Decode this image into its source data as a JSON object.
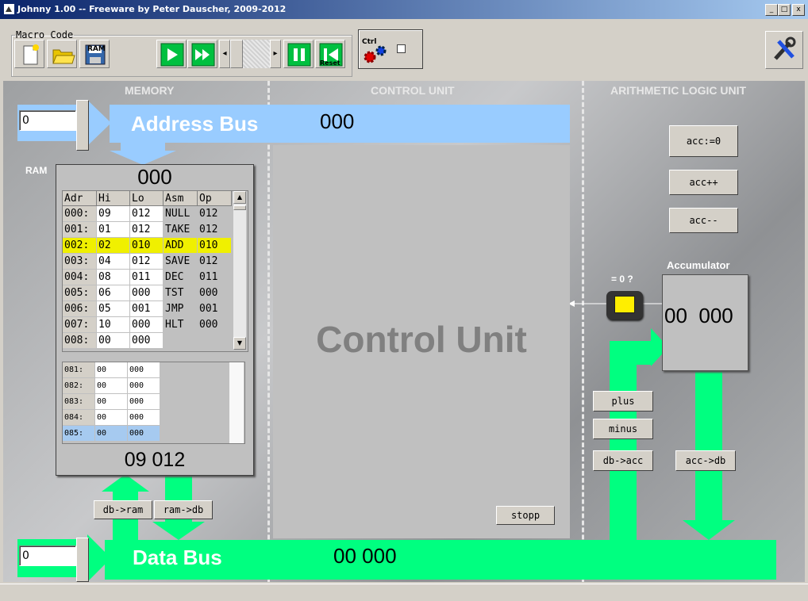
{
  "window": {
    "title": "Johnny 1.00 --  Freeware by Peter Dauscher, 2009-2012",
    "min": "_",
    "max": "□",
    "close": "x"
  },
  "toolbar": {
    "macro_group_label": "Macro Code",
    "ram_label": "RAM",
    "ctrl_label": "Ctrl",
    "reset_label": "Reset"
  },
  "sections": {
    "memory": "MEMORY",
    "control": "CONTROL UNIT",
    "alu": "ARITHMETIC LOGIC UNIT"
  },
  "address_bus": {
    "title": "Address Bus",
    "value": "000",
    "input_value": "0"
  },
  "data_bus": {
    "title": "Data Bus",
    "value": "00  000",
    "input_value": "0"
  },
  "ram": {
    "label": "RAM",
    "address_display": "000",
    "data_display": "09  012",
    "columns": [
      "Adr",
      "Hi",
      "Lo",
      "Asm",
      "Op"
    ],
    "rows": [
      {
        "adr": "000:",
        "hi": "09",
        "lo": "012",
        "asm": "NULL",
        "op": "012",
        "highlight": false
      },
      {
        "adr": "001:",
        "hi": "01",
        "lo": "012",
        "asm": "TAKE",
        "op": "012",
        "highlight": false
      },
      {
        "adr": "002:",
        "hi": "02",
        "lo": "010",
        "asm": "ADD",
        "op": "010",
        "highlight": true
      },
      {
        "adr": "003:",
        "hi": "04",
        "lo": "012",
        "asm": "SAVE",
        "op": "012",
        "highlight": false
      },
      {
        "adr": "004:",
        "hi": "08",
        "lo": "011",
        "asm": "DEC",
        "op": "011",
        "highlight": false
      },
      {
        "adr": "005:",
        "hi": "06",
        "lo": "000",
        "asm": "TST",
        "op": "000",
        "highlight": false
      },
      {
        "adr": "006:",
        "hi": "05",
        "lo": "001",
        "asm": "JMP",
        "op": "001",
        "highlight": false
      },
      {
        "adr": "007:",
        "hi": "10",
        "lo": "000",
        "asm": "HLT",
        "op": "000",
        "highlight": false
      },
      {
        "adr": "008:",
        "hi": "00",
        "lo": "000",
        "asm": "",
        "op": "",
        "highlight": false
      }
    ],
    "micro_rows": [
      {
        "adr": "081:",
        "hi": "00",
        "lo": "000",
        "selected": false
      },
      {
        "adr": "082:",
        "hi": "00",
        "lo": "000",
        "selected": false
      },
      {
        "adr": "083:",
        "hi": "00",
        "lo": "000",
        "selected": false
      },
      {
        "adr": "084:",
        "hi": "00",
        "lo": "000",
        "selected": false
      },
      {
        "adr": "085:",
        "hi": "00",
        "lo": "000",
        "selected": true
      }
    ],
    "btn_db_ram": "db->ram",
    "btn_ram_db": "ram->db"
  },
  "control_unit": {
    "label": "Control Unit",
    "stopp": "stopp"
  },
  "alu": {
    "btn_acc_zero": "acc:=0",
    "btn_acc_inc": "acc++",
    "btn_acc_dec": "acc--",
    "zero_test_label": "= 0 ?",
    "accumulator_label": "Accumulator",
    "accumulator_value": "00  000",
    "btn_plus": "plus",
    "btn_minus": "minus",
    "btn_db_acc": "db->acc",
    "btn_acc_db": "acc->db"
  },
  "colors": {
    "bus_address": "#99ccff",
    "bus_data": "#00ff80",
    "highlight_row": "#f0f000",
    "selected_row": "#a6caf0"
  }
}
